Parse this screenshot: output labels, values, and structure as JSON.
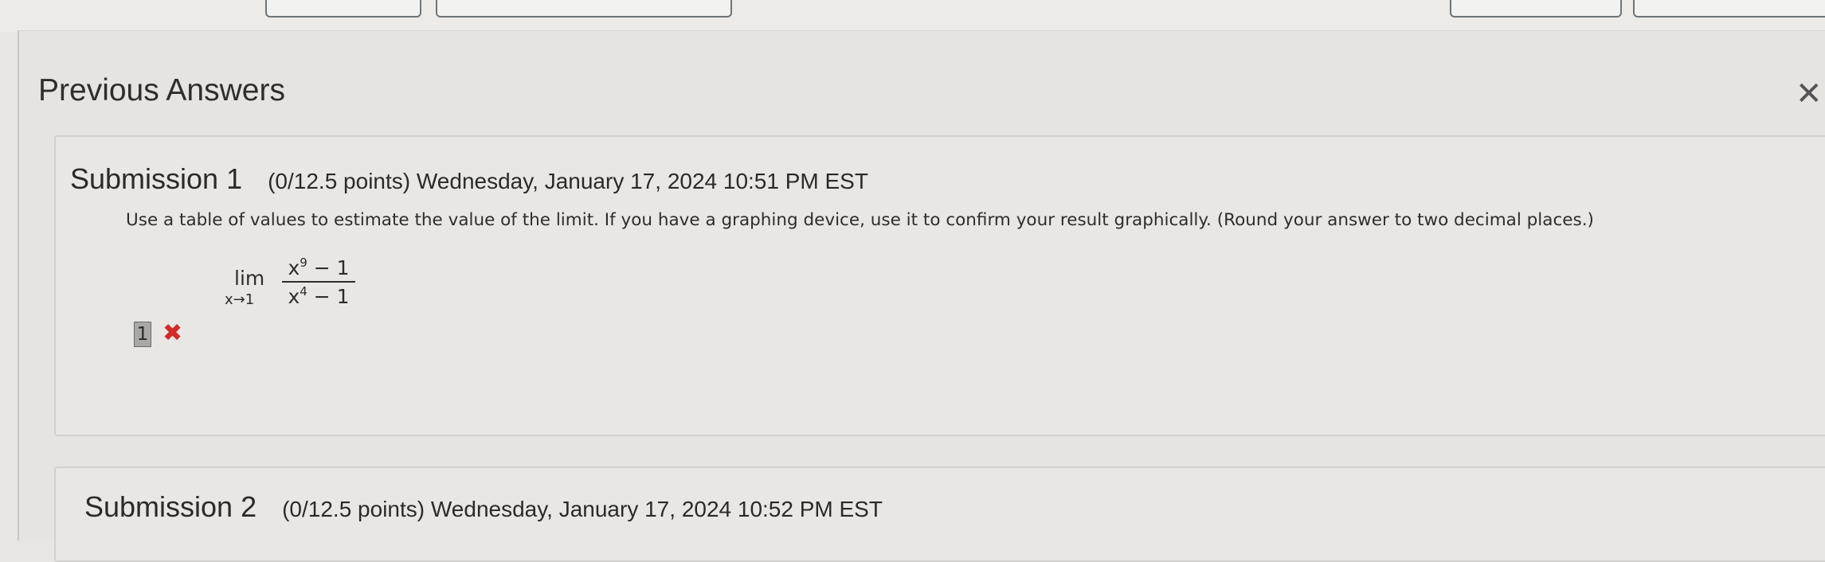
{
  "panel": {
    "title": "Previous Answers",
    "close_icon": "✕"
  },
  "submissions": [
    {
      "name": "Submission 1",
      "meta": "(0/12.5 points) Wednesday, January 17, 2024 10:51 PM EST",
      "question": "Use a table of values to estimate the value of the limit. If you have a graphing device, use it to confirm your result graphically. (Round your answer to two decimal places.)",
      "limit": {
        "lim": "lim",
        "subscript": "x→1",
        "numerator_base": "x",
        "numerator_exp": "9",
        "numerator_rest": " − 1",
        "denominator_base": "x",
        "denominator_exp": "4",
        "denominator_rest": " − 1"
      },
      "answer": "1",
      "result_icon": "incorrect-icon",
      "result_color": "#d22a2a"
    },
    {
      "name": "Submission 2",
      "meta": "(0/12.5 points) Wednesday, January 17, 2024 10:52 PM EST"
    }
  ]
}
